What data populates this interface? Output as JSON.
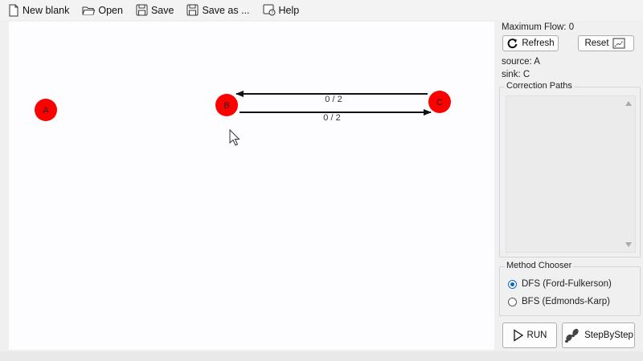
{
  "toolbar": {
    "new_blank": "New blank",
    "open": "Open",
    "save": "Save",
    "save_as": "Save as ...",
    "help": "Help"
  },
  "graph": {
    "nodes": [
      {
        "id": "A",
        "label": "A"
      },
      {
        "id": "B",
        "label": "B"
      },
      {
        "id": "C",
        "label": "C"
      }
    ],
    "edges": [
      {
        "from": "C",
        "to": "B",
        "label": "0 / 2"
      },
      {
        "from": "B",
        "to": "C",
        "label": "0 / 2"
      }
    ],
    "node_color": "#ff0000"
  },
  "panel": {
    "max_flow": "Maximum Flow: 0",
    "refresh": "Refresh",
    "reset": "Reset",
    "source": "source: A",
    "sink": "sink: C",
    "correction_paths_title": "Correction Paths",
    "method_chooser_title": "Method Chooser",
    "methods": [
      {
        "label": "DFS (Ford-Fulkerson)",
        "selected": true
      },
      {
        "label": "BFS (Edmonds-Karp)",
        "selected": false
      }
    ],
    "run": "RUN",
    "step_by_step": "StepByStep"
  }
}
